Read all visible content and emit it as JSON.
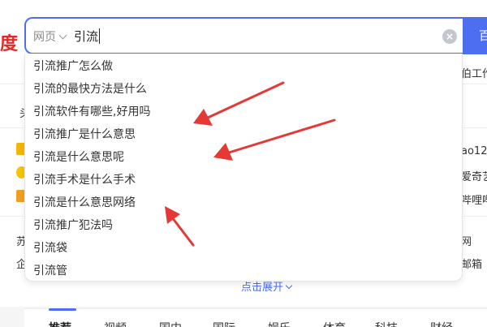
{
  "logo_fragment": "度",
  "search": {
    "scope_label": "网页",
    "query": "引流",
    "clear_glyph": "×",
    "button_label": "百"
  },
  "suggestions": [
    "引流推广怎么做",
    "引流的最快方法是什么",
    "引流软件有哪些,好用吗",
    "引流推广是什么意思",
    "引流是什么意思呢",
    "引流手术是什么手术",
    "引流是什么意思网络",
    "引流推广犯法吗",
    "引流袋",
    "引流管"
  ],
  "background": {
    "right_fragments": [
      "伯工作",
      "ao12",
      "爱奇艺",
      "哔哩哔",
      "网",
      "邮箱"
    ],
    "left_fragments": [
      "头",
      "苏",
      "企"
    ],
    "expand_label": "点击展开"
  },
  "tabs": [
    "推荐",
    "视频",
    "国内",
    "国际",
    "娱乐",
    "体育",
    "科技",
    "财经"
  ],
  "colors": {
    "accent": "#4e6ef2",
    "arrow": "#e53935",
    "logo_red": "#e12a2a"
  }
}
